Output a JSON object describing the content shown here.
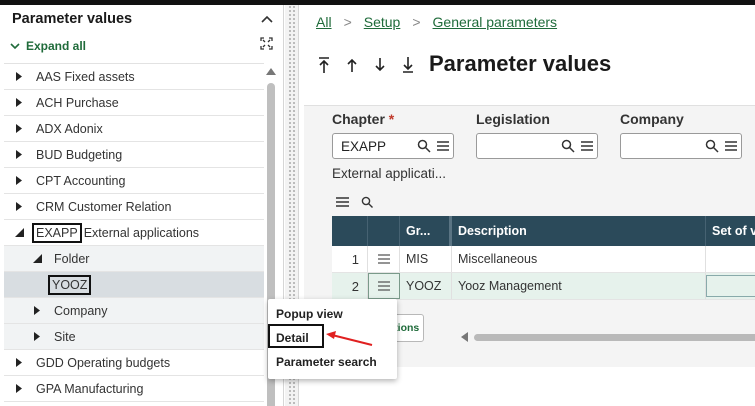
{
  "left_panel": {
    "title": "Parameter values",
    "expand_all": "Expand all",
    "tree": [
      {
        "label": "AAS Fixed assets",
        "level": 0
      },
      {
        "label": "ACH Purchase",
        "level": 0
      },
      {
        "label": "ADX Adonix",
        "level": 0
      },
      {
        "label": "BUD Budgeting",
        "level": 0
      },
      {
        "label": "CPT Accounting",
        "level": 0
      },
      {
        "label": "CRM Customer Relation",
        "level": 0
      },
      {
        "code": "EXAPP",
        "label": "External applications",
        "level": 0,
        "expanded": true
      },
      {
        "label": "Folder",
        "level": 1,
        "expanded": true
      },
      {
        "label": "YOOZ",
        "level": 2,
        "selected": true
      },
      {
        "label": "Company",
        "level": 1
      },
      {
        "label": "Site",
        "level": 1
      },
      {
        "label": "GDD Operating budgets",
        "level": 0
      },
      {
        "label": "GPA Manufacturing",
        "level": 0
      }
    ]
  },
  "breadcrumb": [
    "All",
    "Setup",
    "General parameters"
  ],
  "page_title": "Parameter values",
  "fields": {
    "chapter": {
      "label": "Chapter",
      "required_mark": "*",
      "value": "EXAPP",
      "description": "External applicati..."
    },
    "legislation": {
      "label": "Legislation",
      "value": ""
    },
    "company": {
      "label": "Company",
      "value": ""
    }
  },
  "grid": {
    "headers": [
      "Gr...",
      "Description",
      "Set of v"
    ],
    "rows": [
      {
        "num": "1",
        "group": "MIS",
        "description": "Miscellaneous"
      },
      {
        "num": "2",
        "group": "YOOZ",
        "description": "Yooz Management"
      }
    ]
  },
  "actions_button": "Actions",
  "context_menu": [
    "Popup view",
    "Detail",
    "Parameter search"
  ],
  "colors": {
    "accent": "#1f6b3a",
    "grid_header": "#2b4a5a",
    "highlight": "#e6f2ec",
    "annotation": "#e02020"
  }
}
